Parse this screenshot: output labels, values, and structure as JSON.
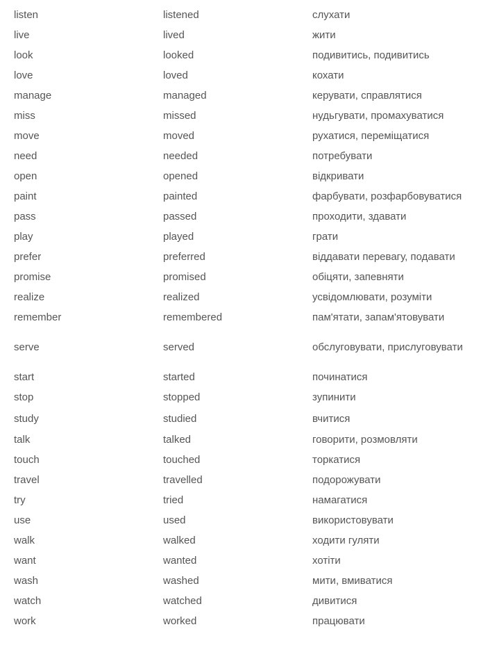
{
  "verbs": [
    {
      "base": "listen",
      "past": "listened",
      "translation": "слухати"
    },
    {
      "base": "live",
      "past": "lived",
      "translation": "жити"
    },
    {
      "base": "look",
      "past": "looked",
      "translation": "подивитись, подивитись"
    },
    {
      "base": "love",
      "past": "loved",
      "translation": "кохати"
    },
    {
      "base": "manage",
      "past": "managed",
      "translation": "керувати, справлятися"
    },
    {
      "base": "miss",
      "past": "missed",
      "translation": "нудьгувати, промахуватися"
    },
    {
      "base": "move",
      "past": "moved",
      "translation": "рухатися, переміщатися"
    },
    {
      "base": "need",
      "past": "needed",
      "translation": "потребувати"
    },
    {
      "base": "open",
      "past": "opened",
      "translation": "відкривати"
    },
    {
      "base": "paint",
      "past": "painted",
      "translation": "фарбувати, розфарбовуватися"
    },
    {
      "base": "pass",
      "past": "passed",
      "translation": "проходити, здавати"
    },
    {
      "base": "play",
      "past": "played",
      "translation": "грати"
    },
    {
      "base": "prefer",
      "past": "preferred",
      "translation": "віддавати перевагу, подавати"
    },
    {
      "base": "promise",
      "past": "promised",
      "translation": "обіцяти, запевняти"
    },
    {
      "base": "realize",
      "past": "realized",
      "translation": "усвідомлювати, розуміти"
    },
    {
      "base": "remember",
      "past": "remembered",
      "translation": "пам'ятати, запам'ятовувати"
    },
    {
      "base": "serve",
      "past": "served",
      "translation": "обслуговувати, прислуговувати"
    },
    {
      "base": "start",
      "past": "started",
      "translation": "починатися"
    },
    {
      "base": "stop",
      "past": "stopped",
      "translation": "зупинити"
    },
    {
      "base": "study",
      "past": "studied",
      "translation": "вчитися"
    },
    {
      "base": "talk",
      "past": "talked",
      "translation": "говорити, розмовляти"
    },
    {
      "base": "touch",
      "past": "touched",
      "translation": "торкатися"
    },
    {
      "base": "travel",
      "past": "travelled",
      "translation": "подорожувати"
    },
    {
      "base": "try",
      "past": "tried",
      "translation": "намагатися"
    },
    {
      "base": "use",
      "past": "used",
      "translation": "використовувати"
    },
    {
      "base": "walk",
      "past": "walked",
      "translation": "ходити гуляти"
    },
    {
      "base": "want",
      "past": "wanted",
      "translation": "хотіти"
    },
    {
      "base": "wash",
      "past": "washed",
      "translation": "мити, вмиватися"
    },
    {
      "base": "watch",
      "past": "watched",
      "translation": "дивитися"
    },
    {
      "base": "work",
      "past": "worked",
      "translation": "працювати"
    }
  ]
}
